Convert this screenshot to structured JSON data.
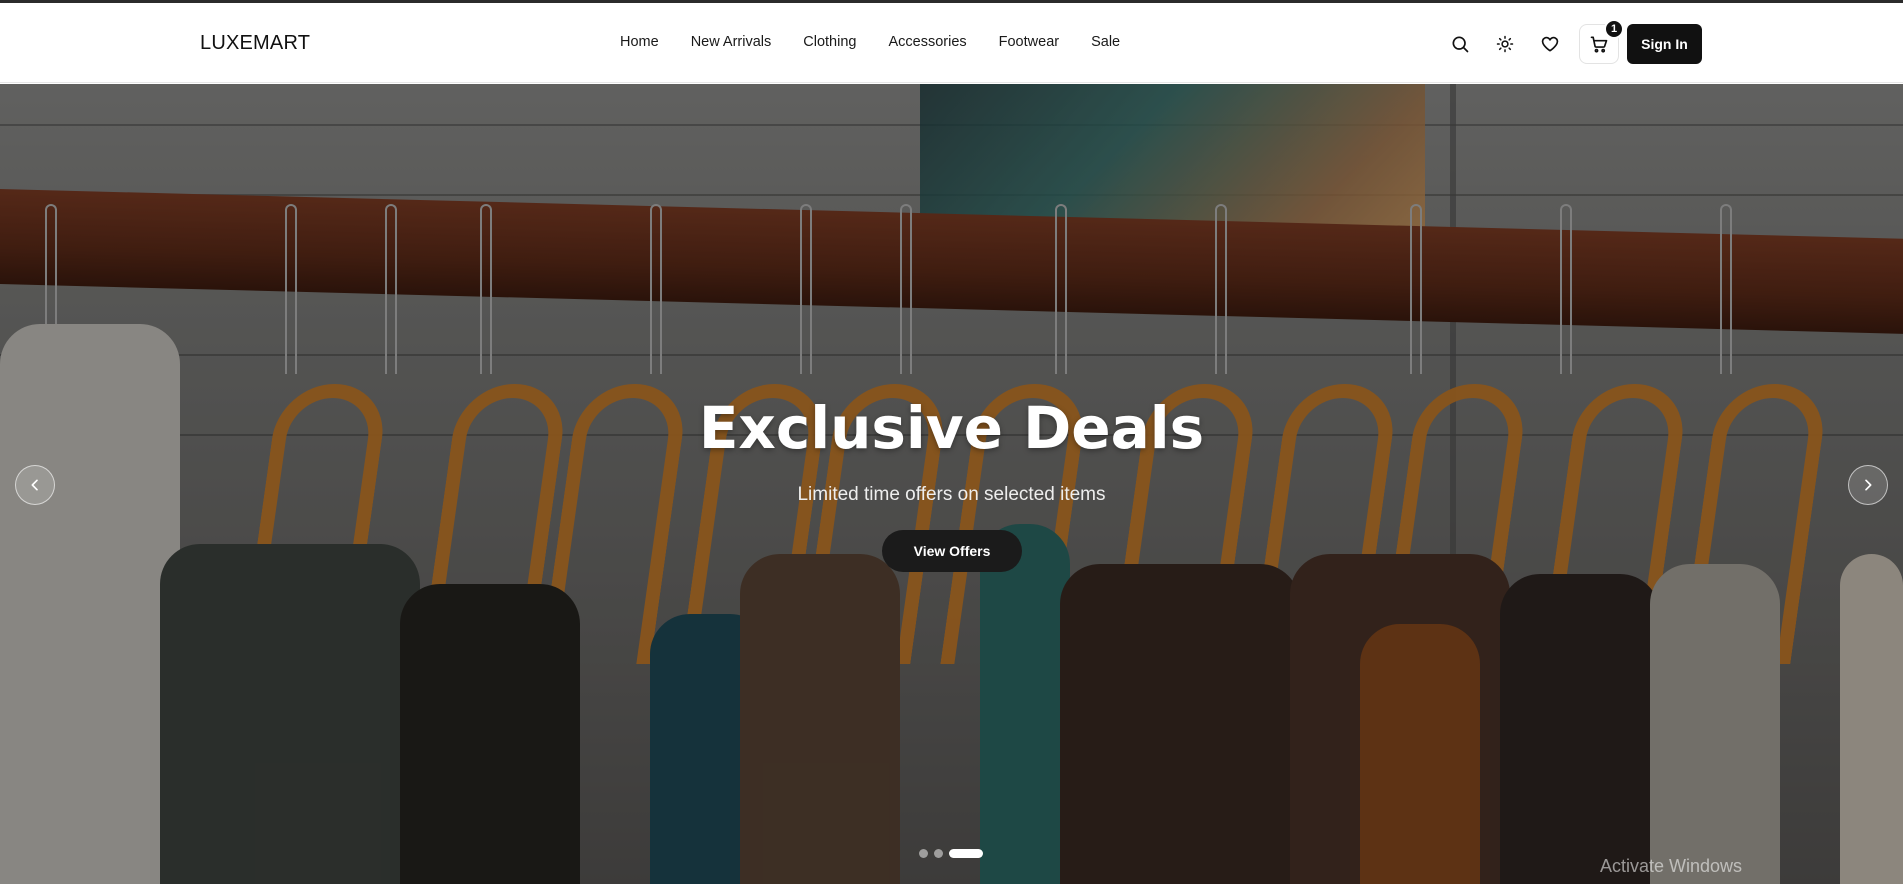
{
  "brand": {
    "name": "LUXEMART"
  },
  "nav": {
    "items": [
      {
        "label": "Home"
      },
      {
        "label": "New Arrivals"
      },
      {
        "label": "Clothing"
      },
      {
        "label": "Accessories"
      },
      {
        "label": "Footwear"
      },
      {
        "label": "Sale"
      }
    ]
  },
  "actions": {
    "icons": [
      "search-icon",
      "theme-toggle-icon",
      "heart-icon",
      "cart-icon"
    ],
    "cart_count": "1",
    "signin_label": "Sign In"
  },
  "hero": {
    "title": "Exclusive Deals",
    "subtitle": "Limited time offers on selected items",
    "cta_label": "View Offers",
    "slides_total": 3,
    "active_slide": 3
  },
  "system": {
    "watermark": "Activate Windows"
  },
  "colors": {
    "primary": "#111111",
    "hanger": "#c97d2a",
    "rail": "#6b321d"
  }
}
